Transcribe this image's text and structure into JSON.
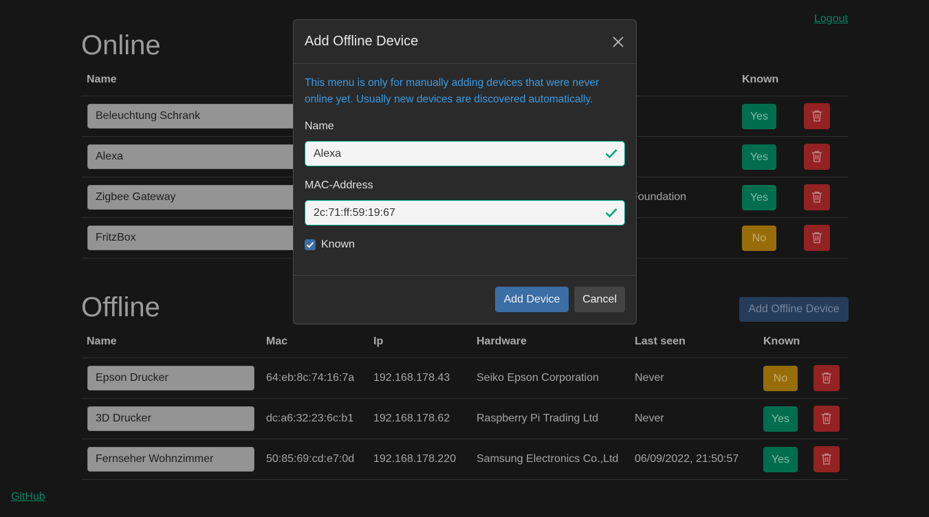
{
  "header": {
    "logout_label": "Logout"
  },
  "footer": {
    "github_label": "GitHub"
  },
  "online": {
    "title": "Online",
    "headers": {
      "name": "Name",
      "known": "Known"
    },
    "rows": [
      {
        "name": "Beleuchtung Schrank",
        "hardware": "",
        "known": "Yes"
      },
      {
        "name": "Alexa",
        "hardware": "",
        "known": "Yes"
      },
      {
        "name": "Zigbee Gateway",
        "hardware": "Foundation",
        "known": "Yes"
      },
      {
        "name": "FritzBox",
        "hardware": "",
        "known": "No"
      }
    ]
  },
  "offline": {
    "title": "Offline",
    "add_button_label": "Add Offline Device",
    "headers": {
      "name": "Name",
      "mac": "Mac",
      "ip": "Ip",
      "hardware": "Hardware",
      "last_seen": "Last seen",
      "known": "Known"
    },
    "rows": [
      {
        "name": "Epson Drucker",
        "mac": "64:eb:8c:74:16:7a",
        "ip": "192.168.178.43",
        "hardware": "Seiko Epson Corporation",
        "last_seen": "Never",
        "known": "No"
      },
      {
        "name": "3D Drucker",
        "mac": "dc:a6:32:23:6c:b1",
        "ip": "192.168.178.62",
        "hardware": "Raspberry Pi Trading Ltd",
        "last_seen": "Never",
        "known": "Yes"
      },
      {
        "name": "Fernseher Wohnzimmer",
        "mac": "50:85:69:cd:e7:0d",
        "ip": "192.168.178.220",
        "hardware": "Samsung Electronics Co.,Ltd",
        "last_seen": "06/09/2022, 21:50:57",
        "known": "Yes"
      }
    ]
  },
  "modal": {
    "title": "Add Offline Device",
    "info": "This menu is only for manually adding devices that were never online yet. Usually new devices are discovered automatically.",
    "name_label": "Name",
    "name_value": "Alexa",
    "mac_label": "MAC-Address",
    "mac_value": "2c:71:ff:59:19:67",
    "known_label": "Known",
    "known_checked": true,
    "add_label": "Add Device",
    "cancel_label": "Cancel"
  },
  "colors": {
    "accent": "#00a67d",
    "primary": "#3a6ea5",
    "danger": "#b42a2a",
    "warning": "#b8860b",
    "success": "#00875f"
  }
}
